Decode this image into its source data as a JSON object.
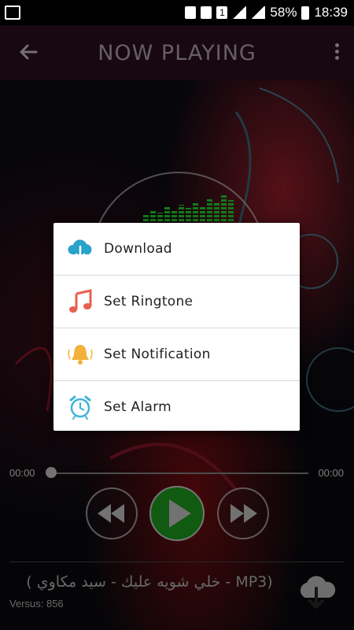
{
  "status_bar": {
    "battery_percent": "58%",
    "time": "18:39",
    "notification_count": "1"
  },
  "header": {
    "title": "NOW PLAYING"
  },
  "menu": {
    "options": [
      {
        "label": "Download",
        "icon": "cloud-download-icon"
      },
      {
        "label": "Set Ringtone",
        "icon": "music-note-icon"
      },
      {
        "label": "Set Notification",
        "icon": "bell-icon"
      },
      {
        "label": "Set Alarm",
        "icon": "alarm-clock-icon"
      }
    ]
  },
  "player": {
    "time_elapsed": "00:00",
    "time_total": "00:00",
    "progress": 0,
    "song_title": "( خلي شويه عليك - سيد مكاوي - MP3)",
    "version": "Versus: 856"
  },
  "colors": {
    "header_bg": "#2a0f22",
    "play_green": "#1fa51f",
    "equalizer_green": "#21e12b"
  }
}
